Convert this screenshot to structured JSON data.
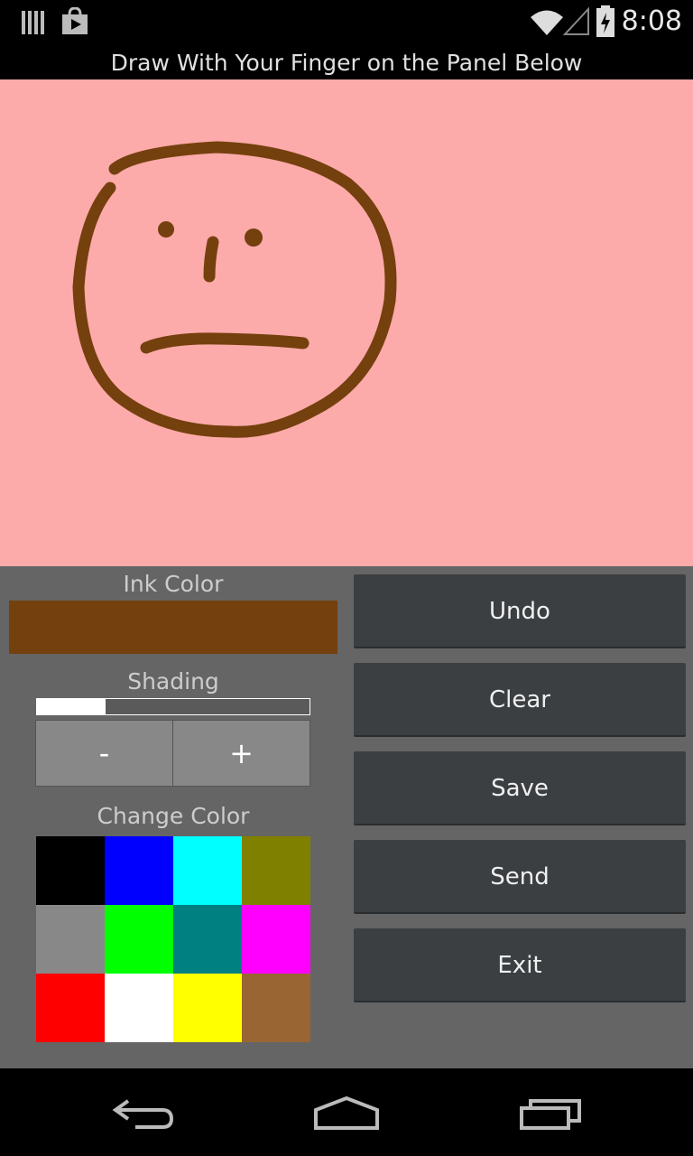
{
  "status_bar": {
    "time": "8:08",
    "icons": [
      "signal-bars-icon",
      "play-store-icon",
      "wifi-icon",
      "cell-signal-icon",
      "battery-charging-icon"
    ]
  },
  "app": {
    "title": "Draw With Your Finger on the Panel Below",
    "canvas_background": "#fdaaaa",
    "stroke_color": "#74400e"
  },
  "controls": {
    "ink_color_label": "Ink Color",
    "ink_color": "#74400e",
    "shading_label": "Shading",
    "shading_level": 0.25,
    "minus_label": "-",
    "plus_label": "+",
    "change_color_label": "Change Color",
    "palette": [
      "#000000",
      "#0000ff",
      "#00ffff",
      "#808000",
      "#888888",
      "#00ff00",
      "#008080",
      "#ff00ff",
      "#ff0000",
      "#ffffff",
      "#ffff00",
      "#996633"
    ]
  },
  "buttons": {
    "undo": "Undo",
    "clear": "Clear",
    "save": "Save",
    "send": "Send",
    "exit": "Exit"
  },
  "nav_bar": {
    "icons": [
      "back-icon",
      "home-icon",
      "recents-icon"
    ]
  }
}
